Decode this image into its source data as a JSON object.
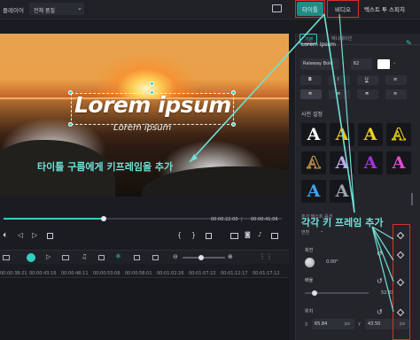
{
  "topbar": {
    "player_label": "플레이어",
    "quality_value": "전체 품질",
    "tabs": [
      "타이틀",
      "비디오",
      "텍스트 투 스피치"
    ]
  },
  "viewer": {
    "title_text": "Lorem ipsum",
    "subtitle_text": "Lorem ipsum"
  },
  "playback": {
    "current_time": "00:00:22:00",
    "total_time": "00:00:41:06",
    "progress": 0.36
  },
  "timeline": {
    "ticks": [
      "00:00:38:21",
      "00:00:43:16",
      "00:00:48:11",
      "00:00:53:06",
      "00:00:58:01",
      "00:01:02:26",
      "00:01:07:22",
      "00:01:12:17",
      "00:01:17:12"
    ]
  },
  "panel": {
    "subtabs": [
      "기본",
      "애니메이션"
    ],
    "section_title": "Lorem ipsum",
    "font_name": "Raleway Bold",
    "font_size": "62",
    "preset_label": "사전 설정",
    "more_text_options": "추가 텍스트 옵션",
    "transform_label": "변환",
    "rotate_label": "회전",
    "rotate_value": "0.00°",
    "scale_label": "배율",
    "scale_value": "52.83",
    "scale_progress": 0.15,
    "position_label": "위치",
    "pos_x_label": "X",
    "pos_x_value": "65.84",
    "pos_unit": "px",
    "pos_y_label": "Y",
    "pos_y_value": "43.50"
  },
  "annotations": {
    "left": "타이틀 구름에게 키프레임을 추가",
    "right": "각각 키 프레임 추가"
  },
  "colors": {
    "accent": "#2fd0c3",
    "annotation": "#6ee2d7",
    "highlight_box": "#d3322e"
  }
}
